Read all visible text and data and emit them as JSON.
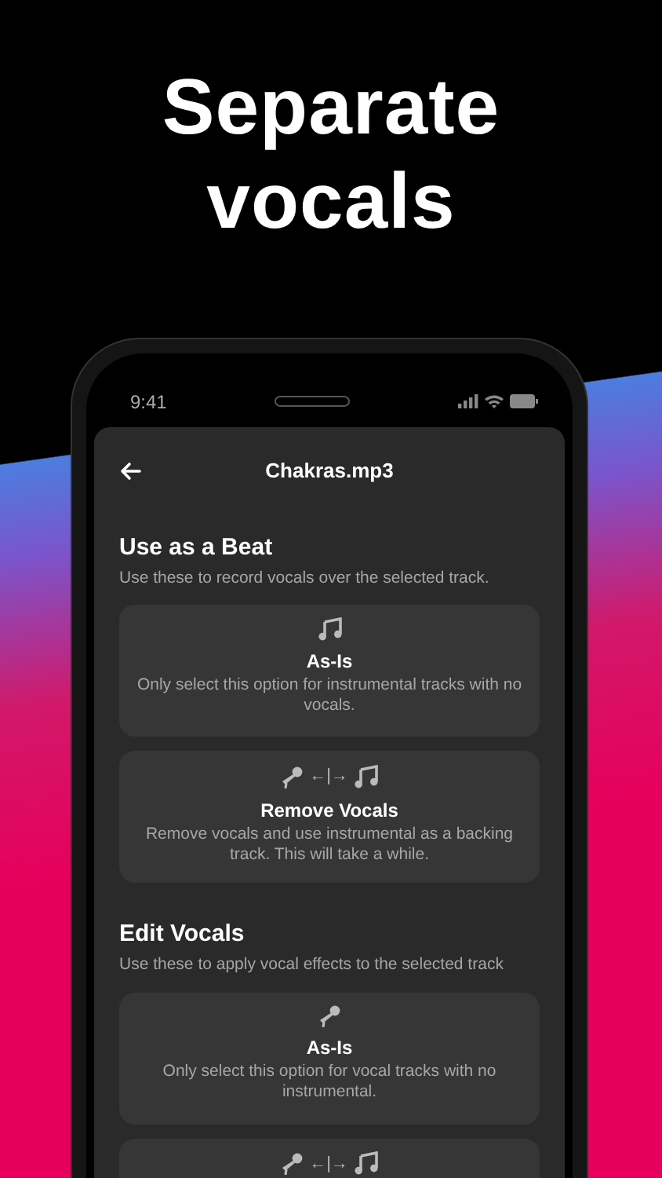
{
  "headline": [
    "Separate",
    "vocals"
  ],
  "status_bar": {
    "time": "9:41"
  },
  "header": {
    "title": "Chakras.mp3"
  },
  "sections": [
    {
      "title": "Use as a Beat",
      "subtitle": "Use these to record vocals over the selected track.",
      "options": [
        {
          "kind": "note",
          "title": "As-Is",
          "description": "Only select this option for instrumental tracks with no vocals."
        },
        {
          "kind": "mic-note",
          "separator": "←|→",
          "title": "Remove Vocals",
          "description": "Remove vocals and use instrumental as a backing track. This will take a while."
        }
      ]
    },
    {
      "title": "Edit Vocals",
      "subtitle": "Use these to apply vocal effects to the selected track",
      "options": [
        {
          "kind": "mic",
          "title": "As-Is",
          "description": "Only select this option for vocal tracks with no instrumental."
        },
        {
          "kind": "mic-note",
          "separator": "←|→"
        }
      ]
    }
  ]
}
